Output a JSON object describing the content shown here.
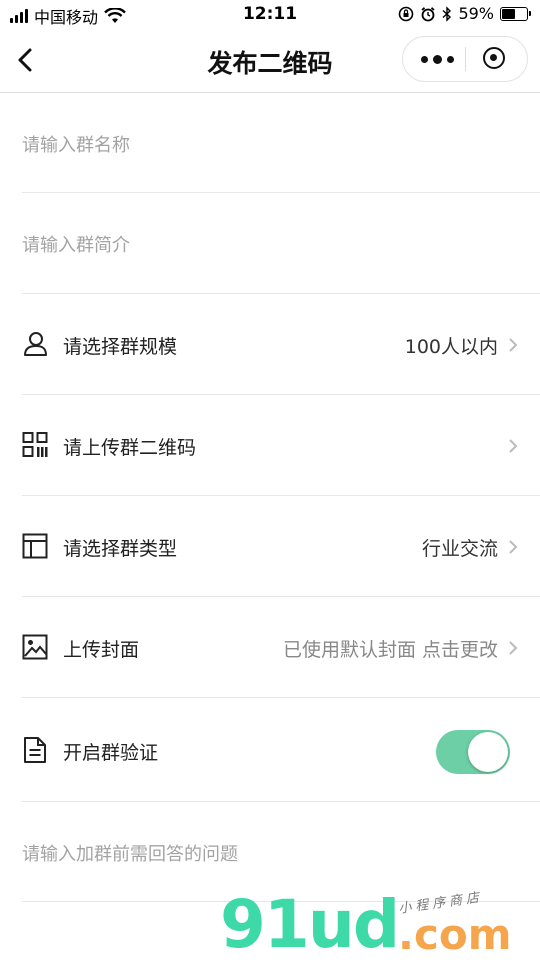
{
  "status_bar": {
    "carrier": "中国移动",
    "time": "12:11",
    "battery_percent": "59%",
    "battery_level": 0.59
  },
  "nav": {
    "title": "发布二维码",
    "back_icon": "chevron-left-icon",
    "more_icon": "more-dots-icon",
    "close_icon": "target-circle-icon"
  },
  "form": {
    "group_name_placeholder": "请输入群名称",
    "group_intro_placeholder": "请输入群简介",
    "scale": {
      "label": "请选择群规模",
      "value": "100人以内",
      "icon": "user-icon"
    },
    "qrcode": {
      "label": "请上传群二维码",
      "value": "",
      "icon": "qrcode-icon"
    },
    "type": {
      "label": "请选择群类型",
      "value": "行业交流",
      "icon": "layout-icon"
    },
    "cover": {
      "label": "上传封面",
      "value": "已使用默认封面 点击更改",
      "icon": "image-icon"
    },
    "verify": {
      "label": "开启群验证",
      "enabled": true,
      "icon": "document-icon"
    },
    "question_placeholder": "请输入加群前需回答的问题"
  },
  "watermark": {
    "brand": "91ud",
    "domain": ".com",
    "tagline": "小程序商店"
  },
  "colors": {
    "toggle_on": "#6ccfa6",
    "placeholder": "#a3a3a3"
  }
}
